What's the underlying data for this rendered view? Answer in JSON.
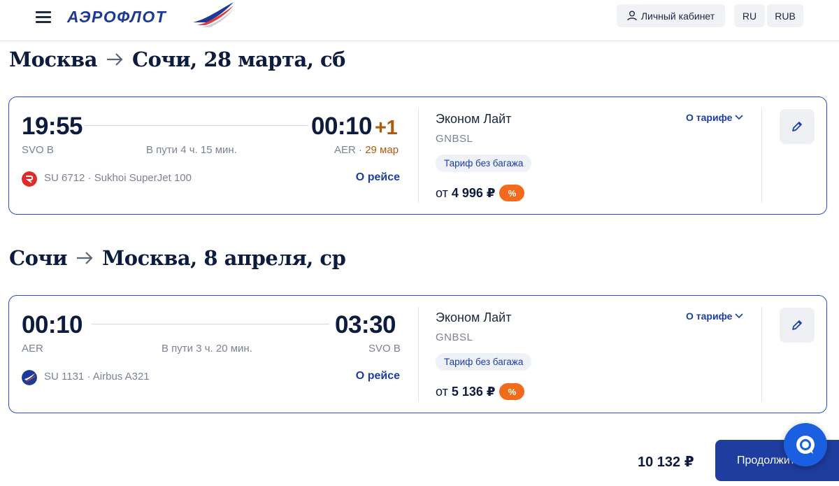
{
  "header": {
    "logo_text": "АЭРОФЛОТ",
    "cabinet_label": "Личный кабинет",
    "language": "RU",
    "currency": "RUB"
  },
  "segments": [
    {
      "title_from": "Москва",
      "title_to": "Сочи, 28 марта, сб",
      "depart_time": "19:55",
      "arrive_time": "00:10",
      "day_offset": "+1",
      "depart_airport": "SVO B",
      "duration": "В пути 4 ч. 15 мин.",
      "arrive_airport": "AER",
      "arrive_date_sep": " · ",
      "arrive_date": "29 мар",
      "flight_info": "SU 6712 · Sukhoi SuperJet 100",
      "about_flight": "О рейсе",
      "tariff_name": "Эконом Лайт",
      "tariff_code": "GNBSL",
      "about_tariff": "О тарифе",
      "badge": "Тариф без багажа",
      "price_prefix": "от",
      "price": "4 996 ₽",
      "discount": "%",
      "airline_icon": "rossiya-airline-icon"
    },
    {
      "title_from": "Сочи",
      "title_to": "Москва, 8 апреля, ср",
      "depart_time": "00:10",
      "arrive_time": "03:30",
      "depart_airport": "AER",
      "duration": "В пути 3 ч. 20 мин.",
      "arrive_airport": "SVO B",
      "flight_info": "SU 1131 · Airbus A321",
      "about_flight": "О рейсе",
      "tariff_name": "Эконом Лайт",
      "tariff_code": "GNBSL",
      "about_tariff": "О тарифе",
      "badge": "Тариф без багажа",
      "price_prefix": "от",
      "price": "5 136 ₽",
      "discount": "%",
      "airline_icon": "aeroflot-airline-icon"
    }
  ],
  "footer": {
    "total": "10 132 ₽",
    "continue_label": "Продолжить"
  },
  "colors": {
    "brand_blue": "#1f3d9f",
    "card_border": "#2b4ec9",
    "discount_orange": "#f26a1b",
    "day_offset": "#b05a0c"
  }
}
